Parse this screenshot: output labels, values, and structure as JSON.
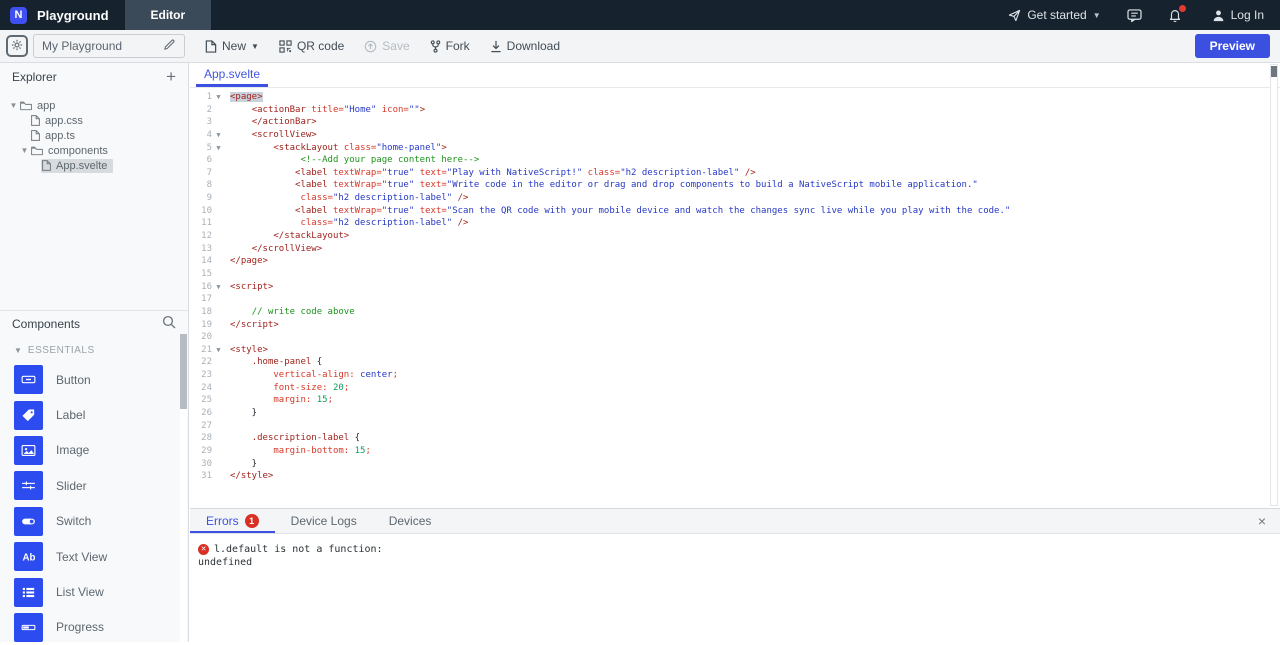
{
  "theme": {
    "accent_blue": "#3b4fe0",
    "icon_blue": "#2d4cf0",
    "error_red": "#d93025",
    "header_bg": "#16222d"
  },
  "header": {
    "logo": "N",
    "brand": "Playground",
    "nav_tab": "Editor",
    "get_started": "Get started",
    "login": "Log In"
  },
  "toolbar": {
    "playground_name": "My Playground",
    "new_label": "New",
    "qr_label": "QR code",
    "save_label": "Save",
    "fork_label": "Fork",
    "download_label": "Download",
    "preview_label": "Preview"
  },
  "explorer": {
    "title": "Explorer",
    "add_label": "+",
    "tree": [
      {
        "label": "app",
        "kind": "folder",
        "depth": 0,
        "expanded": true
      },
      {
        "label": "app.css",
        "kind": "file",
        "depth": 1
      },
      {
        "label": "app.ts",
        "kind": "file",
        "depth": 1
      },
      {
        "label": "components",
        "kind": "folder",
        "depth": 1,
        "expanded": true
      },
      {
        "label": "App.svelte",
        "kind": "file",
        "depth": 2,
        "selected": true
      }
    ]
  },
  "components": {
    "title": "Components",
    "section_label": "ESSENTIALS",
    "items": [
      {
        "label": "Button",
        "icon": "button-icon"
      },
      {
        "label": "Label",
        "icon": "label-icon"
      },
      {
        "label": "Image",
        "icon": "image-icon"
      },
      {
        "label": "Slider",
        "icon": "slider-icon"
      },
      {
        "label": "Switch",
        "icon": "switch-icon"
      },
      {
        "label": "Text View",
        "icon": "textview-icon"
      },
      {
        "label": "List View",
        "icon": "listview-icon"
      },
      {
        "label": "Progress",
        "icon": "progress-icon"
      }
    ]
  },
  "editor": {
    "tab": "App.svelte",
    "lines": [
      {
        "n": 1,
        "f": 1,
        "tk": [
          [
            "t",
            "<page>",
            "sel"
          ]
        ]
      },
      {
        "n": 2,
        "tk": [
          [
            "p",
            "    "
          ],
          [
            "t",
            "<actionBar"
          ],
          [
            "p",
            " "
          ],
          [
            "a",
            "title="
          ],
          [
            "s",
            "\"Home\""
          ],
          [
            "p",
            " "
          ],
          [
            "a",
            "icon="
          ],
          [
            "s",
            "\"\""
          ],
          [
            "t",
            ">"
          ]
        ]
      },
      {
        "n": 3,
        "tk": [
          [
            "p",
            "    "
          ],
          [
            "t",
            "</actionBar>"
          ]
        ]
      },
      {
        "n": 4,
        "f": 1,
        "tk": [
          [
            "p",
            "    "
          ],
          [
            "t",
            "<scrollView>"
          ]
        ]
      },
      {
        "n": 5,
        "f": 1,
        "tk": [
          [
            "p",
            "        "
          ],
          [
            "t",
            "<stackLayout"
          ],
          [
            "p",
            " "
          ],
          [
            "a",
            "class="
          ],
          [
            "s",
            "\"home-panel\""
          ],
          [
            "t",
            ">"
          ]
        ]
      },
      {
        "n": 6,
        "tk": [
          [
            "p",
            "             "
          ],
          [
            "c",
            "<!--Add your page content here-->"
          ]
        ]
      },
      {
        "n": 7,
        "tk": [
          [
            "p",
            "            "
          ],
          [
            "t",
            "<label"
          ],
          [
            "p",
            " "
          ],
          [
            "a",
            "textWrap="
          ],
          [
            "s",
            "\"true\""
          ],
          [
            "p",
            " "
          ],
          [
            "a",
            "text="
          ],
          [
            "s",
            "\"Play with NativeScript!\""
          ],
          [
            "p",
            " "
          ],
          [
            "a",
            "class="
          ],
          [
            "s",
            "\"h2 description-label\""
          ],
          [
            "p",
            " "
          ],
          [
            "t",
            "/>"
          ]
        ]
      },
      {
        "n": 8,
        "tk": [
          [
            "p",
            "            "
          ],
          [
            "t",
            "<label"
          ],
          [
            "p",
            " "
          ],
          [
            "a",
            "textWrap="
          ],
          [
            "s",
            "\"true\""
          ],
          [
            "p",
            " "
          ],
          [
            "a",
            "text="
          ],
          [
            "s",
            "\"Write code in the editor or drag and drop components to build a NativeScript mobile application.\""
          ]
        ]
      },
      {
        "n": 9,
        "tk": [
          [
            "p",
            "             "
          ],
          [
            "a",
            "class="
          ],
          [
            "s",
            "\"h2 description-label\""
          ],
          [
            "p",
            " "
          ],
          [
            "t",
            "/>"
          ]
        ]
      },
      {
        "n": 10,
        "tk": [
          [
            "p",
            "            "
          ],
          [
            "t",
            "<label"
          ],
          [
            "p",
            " "
          ],
          [
            "a",
            "textWrap="
          ],
          [
            "s",
            "\"true\""
          ],
          [
            "p",
            " "
          ],
          [
            "a",
            "text="
          ],
          [
            "s",
            "\"Scan the QR code with your mobile device and watch the changes sync live while you play with the code.\""
          ]
        ]
      },
      {
        "n": 11,
        "tk": [
          [
            "p",
            "             "
          ],
          [
            "a",
            "class="
          ],
          [
            "s",
            "\"h2 description-label\""
          ],
          [
            "p",
            " "
          ],
          [
            "t",
            "/>"
          ]
        ]
      },
      {
        "n": 12,
        "tk": [
          [
            "p",
            "        "
          ],
          [
            "t",
            "</stackLayout>"
          ]
        ]
      },
      {
        "n": 13,
        "tk": [
          [
            "p",
            "    "
          ],
          [
            "t",
            "</scrollView>"
          ]
        ]
      },
      {
        "n": 14,
        "tk": [
          [
            "t",
            "</page>"
          ]
        ]
      },
      {
        "n": 15,
        "tk": []
      },
      {
        "n": 16,
        "f": 1,
        "tk": [
          [
            "t",
            "<script>"
          ]
        ]
      },
      {
        "n": 17,
        "tk": []
      },
      {
        "n": 18,
        "tk": [
          [
            "p",
            "    "
          ],
          [
            "c",
            "// write code above"
          ]
        ]
      },
      {
        "n": 19,
        "tk": [
          [
            "t",
            "</script>"
          ]
        ]
      },
      {
        "n": 20,
        "tk": []
      },
      {
        "n": 21,
        "f": 1,
        "tk": [
          [
            "t",
            "<style>"
          ]
        ]
      },
      {
        "n": 22,
        "tk": [
          [
            "p",
            "    "
          ],
          [
            "t",
            ".home-panel"
          ],
          [
            "p",
            " {"
          ]
        ]
      },
      {
        "n": 23,
        "tk": [
          [
            "p",
            "        "
          ],
          [
            "a",
            "vertical-align:"
          ],
          [
            "p",
            " "
          ],
          [
            "s",
            "center"
          ],
          [
            "a",
            ";"
          ]
        ]
      },
      {
        "n": 24,
        "tk": [
          [
            "p",
            "        "
          ],
          [
            "a",
            "font-size:"
          ],
          [
            "p",
            " "
          ],
          [
            "n",
            "20"
          ],
          [
            "a",
            ";"
          ]
        ]
      },
      {
        "n": 25,
        "tk": [
          [
            "p",
            "        "
          ],
          [
            "a",
            "margin:"
          ],
          [
            "p",
            " "
          ],
          [
            "n",
            "15"
          ],
          [
            "a",
            ";"
          ]
        ]
      },
      {
        "n": 26,
        "tk": [
          [
            "p",
            "    }"
          ]
        ]
      },
      {
        "n": 27,
        "tk": []
      },
      {
        "n": 28,
        "tk": [
          [
            "p",
            "    "
          ],
          [
            "t",
            ".description-label"
          ],
          [
            "p",
            " {"
          ]
        ]
      },
      {
        "n": 29,
        "tk": [
          [
            "p",
            "        "
          ],
          [
            "a",
            "margin-bottom:"
          ],
          [
            "p",
            " "
          ],
          [
            "n",
            "15"
          ],
          [
            "a",
            ";"
          ]
        ]
      },
      {
        "n": 30,
        "tk": [
          [
            "p",
            "    }"
          ]
        ]
      },
      {
        "n": 31,
        "tk": [
          [
            "t",
            "</style>"
          ]
        ]
      }
    ]
  },
  "bottom": {
    "tabs": [
      {
        "label": "Errors",
        "badge": "1",
        "active": true
      },
      {
        "label": "Device Logs"
      },
      {
        "label": "Devices"
      }
    ],
    "close_label": "×",
    "error_line1": "l.default is not a function:",
    "error_line2": "undefined"
  }
}
